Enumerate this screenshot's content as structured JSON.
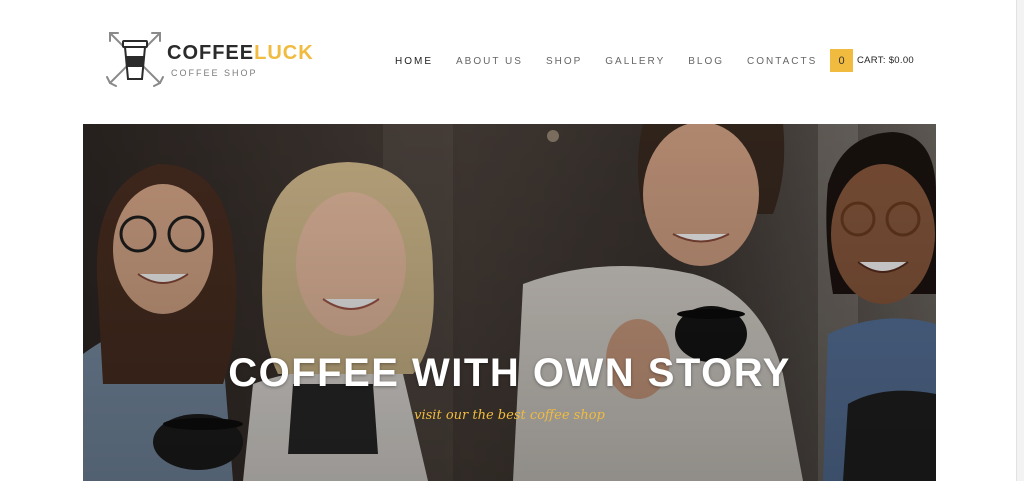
{
  "header": {
    "brand_main": "COFFEE",
    "brand_accent": "LUCK",
    "tagline": "COFFEE SHOP"
  },
  "nav": {
    "items": [
      {
        "label": "HOME",
        "active": true
      },
      {
        "label": "ABOUT US",
        "active": false
      },
      {
        "label": "SHOP",
        "active": false
      },
      {
        "label": "GALLERY",
        "active": false
      },
      {
        "label": "BLOG",
        "active": false
      },
      {
        "label": "CONTACTS",
        "active": false
      }
    ]
  },
  "cart": {
    "count": "0",
    "label": "CART: $0.00"
  },
  "hero": {
    "title": "COFFEE WITH OWN STORY",
    "subtitle": "visit our the best coffee shop"
  },
  "colors": {
    "accent": "#f0bb3f",
    "text_dark": "#222222",
    "nav_text": "#666666"
  }
}
